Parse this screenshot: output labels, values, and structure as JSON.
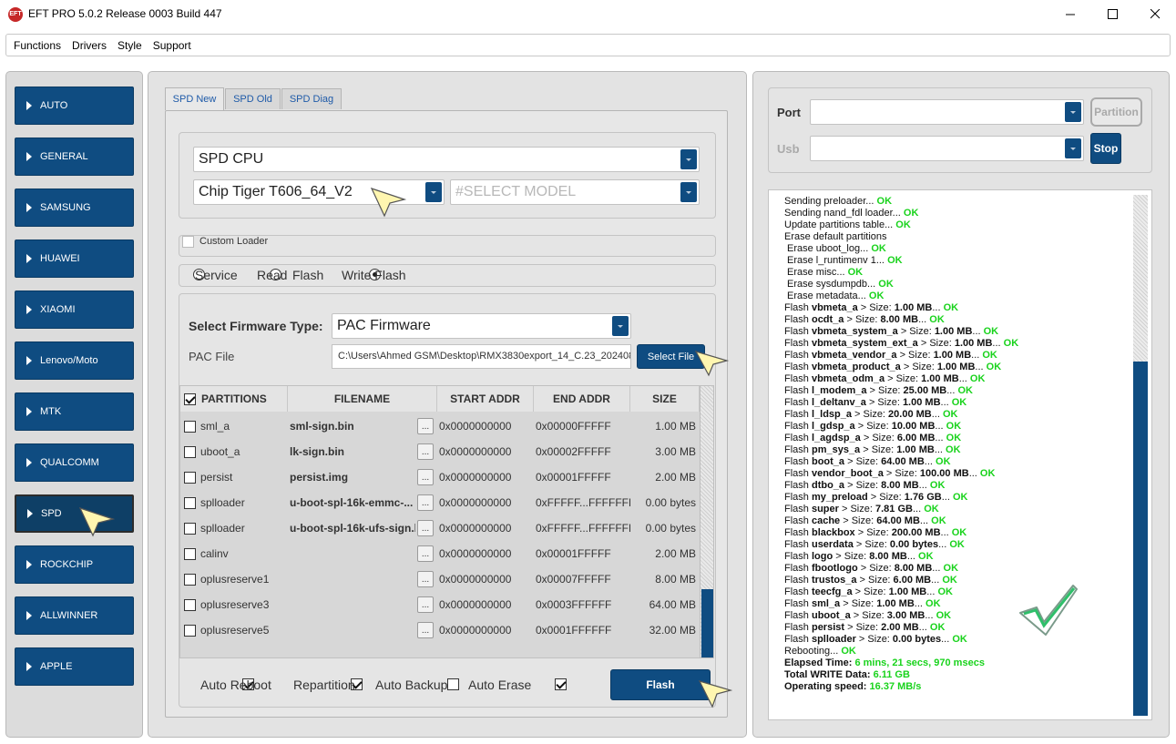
{
  "window": {
    "title": "EFT PRO 5.0.2 Release 0003 Build 447",
    "app_icon_text": "EFT",
    "minimize": "—",
    "maximize": "☐",
    "close": "✕"
  },
  "menu": [
    "Functions",
    "Drivers",
    "Style",
    "Support"
  ],
  "nav": {
    "items": [
      "AUTO",
      "GENERAL",
      "SAMSUNG",
      "HUAWEI",
      "XIAOMI",
      "Lenovo/Moto",
      "MTK",
      "QUALCOMM",
      "SPD",
      "ROCKCHIP",
      "ALLWINNER",
      "APPLE"
    ],
    "active": "SPD"
  },
  "tabs": [
    "SPD New",
    "SPD Old",
    "SPD Diag"
  ],
  "cpu_select": "SPD CPU",
  "chip_select": "Chip Tiger T606_64_V2",
  "model_placeholder": "#SELECT MODEL",
  "custom_loader": {
    "label": "Custom Loader",
    "checked": false
  },
  "modes": [
    {
      "label": "Service",
      "checked": false
    },
    {
      "label": "Read",
      "checked": false
    },
    {
      "label": "Flash",
      "checked": false
    },
    {
      "label": "Write Flash",
      "checked": true
    }
  ],
  "firmware": {
    "type_label": "Select Firmware Type:",
    "type_value": "PAC Firmware",
    "pac_label": "PAC File",
    "pac_path": "C:\\Users\\Ahmed GSM\\Desktop\\RMX3830export_14_C.23_202408",
    "select_file": "Select File"
  },
  "table": {
    "headers": [
      "PARTITIONS",
      "FILENAME",
      "START ADDR",
      "END ADDR",
      "SIZE"
    ],
    "rows": [
      {
        "name": "sml_a",
        "file": "sml-sign.bin",
        "start": "0x0000000000",
        "end": "0x00000FFFFF",
        "size": "1.00 MB"
      },
      {
        "name": "uboot_a",
        "file": "lk-sign.bin",
        "start": "0x0000000000",
        "end": "0x00002FFFFF",
        "size": "3.00 MB"
      },
      {
        "name": "persist",
        "file": "persist.img",
        "start": "0x0000000000",
        "end": "0x00001FFFFF",
        "size": "2.00 MB"
      },
      {
        "name": "splloader",
        "file": "u-boot-spl-16k-emmc-...",
        "start": "0x0000000000",
        "end": "0xFFFFF...FFFFFFF",
        "size": "0.00 bytes"
      },
      {
        "name": "splloader",
        "file": "u-boot-spl-16k-ufs-sign.b",
        "start": "0x0000000000",
        "end": "0xFFFFF...FFFFFFF",
        "size": "0.00 bytes"
      },
      {
        "name": "calinv",
        "file": "",
        "start": "0x0000000000",
        "end": "0x00001FFFFF",
        "size": "2.00 MB"
      },
      {
        "name": "oplusreserve1",
        "file": "",
        "start": "0x0000000000",
        "end": "0x00007FFFFF",
        "size": "8.00 MB"
      },
      {
        "name": "oplusreserve3",
        "file": "",
        "start": "0x0000000000",
        "end": "0x0003FFFFFF",
        "size": "64.00 MB"
      },
      {
        "name": "oplusreserve5",
        "file": "",
        "start": "0x0000000000",
        "end": "0x0001FFFFFF",
        "size": "32.00 MB"
      }
    ],
    "browse": "..."
  },
  "options": [
    {
      "label": "Auto Reboot",
      "checked": true
    },
    {
      "label": "Repartition",
      "checked": true
    },
    {
      "label": "Auto Backup",
      "checked": false
    },
    {
      "label": "Auto Erase",
      "checked": true
    }
  ],
  "flash_button": "Flash",
  "port": {
    "label": "Port",
    "button": "Partition"
  },
  "usb": {
    "label": "Usb",
    "button": "Stop"
  },
  "log": [
    {
      "text": "Sending preloader... ",
      "ok": "OK",
      "indent": 0,
      "bold": false
    },
    {
      "text": "Sending nand_fdl loader... ",
      "ok": "OK",
      "indent": 0,
      "bold": false
    },
    {
      "text": "Update partitions table... ",
      "ok": "OK",
      "indent": 0,
      "bold": false
    },
    {
      "text": "Erase default partitions",
      "ok": "",
      "indent": 0,
      "bold": false
    },
    {
      "text": "Erase uboot_log... ",
      "ok": "OK",
      "indent": 1,
      "bold": false
    },
    {
      "text": "Erase l_runtimenv 1... ",
      "ok": "OK",
      "indent": 1,
      "bold": false
    },
    {
      "text": "Erase misc... ",
      "ok": "OK",
      "indent": 1,
      "bold": false
    },
    {
      "text": "Erase sysdumpdb... ",
      "ok": "OK",
      "indent": 1,
      "bold": false
    },
    {
      "text": "Erase metadata... ",
      "ok": "OK",
      "indent": 1,
      "bold": false
    },
    {
      "pre": "Flash ",
      "name": "vbmeta_a",
      "text": " > Size: ",
      "size": "1.00 MB",
      "ok": "OK"
    },
    {
      "pre": "Flash ",
      "name": "ocdt_a",
      "text": " > Size: ",
      "size": "8.00 MB",
      "ok": "OK"
    },
    {
      "pre": "Flash ",
      "name": "vbmeta_system_a",
      "text": " > Size: ",
      "size": "1.00 MB",
      "ok": "OK"
    },
    {
      "pre": "Flash ",
      "name": "vbmeta_system_ext_a",
      "text": " > Size: ",
      "size": "1.00 MB",
      "ok": "OK"
    },
    {
      "pre": "Flash ",
      "name": "vbmeta_vendor_a",
      "text": " > Size: ",
      "size": "1.00 MB",
      "ok": "OK"
    },
    {
      "pre": "Flash ",
      "name": "vbmeta_product_a",
      "text": " > Size: ",
      "size": "1.00 MB",
      "ok": "OK"
    },
    {
      "pre": "Flash ",
      "name": "vbmeta_odm_a",
      "text": " > Size: ",
      "size": "1.00 MB",
      "ok": "OK"
    },
    {
      "pre": "Flash ",
      "name": "l_modem_a",
      "text": " > Size: ",
      "size": "25.00 MB",
      "ok": "OK"
    },
    {
      "pre": "Flash ",
      "name": "l_deltanv_a",
      "text": " > Size: ",
      "size": "1.00 MB",
      "ok": "OK"
    },
    {
      "pre": "Flash ",
      "name": "l_ldsp_a",
      "text": " > Size: ",
      "size": "20.00 MB",
      "ok": "OK"
    },
    {
      "pre": "Flash ",
      "name": "l_gdsp_a",
      "text": " > Size: ",
      "size": "10.00 MB",
      "ok": "OK"
    },
    {
      "pre": "Flash ",
      "name": "l_agdsp_a",
      "text": " > Size: ",
      "size": "6.00 MB",
      "ok": "OK"
    },
    {
      "pre": "Flash ",
      "name": "pm_sys_a",
      "text": " > Size: ",
      "size": "1.00 MB",
      "ok": "OK"
    },
    {
      "pre": "Flash ",
      "name": "boot_a",
      "text": " > Size: ",
      "size": "64.00 MB",
      "ok": "OK"
    },
    {
      "pre": "Flash ",
      "name": "vendor_boot_a",
      "text": " > Size: ",
      "size": "100.00 MB",
      "ok": "OK"
    },
    {
      "pre": "Flash ",
      "name": "dtbo_a",
      "text": " > Size: ",
      "size": "8.00 MB",
      "ok": "OK"
    },
    {
      "pre": "Flash ",
      "name": "my_preload",
      "text": " > Size: ",
      "size": "1.76 GB",
      "ok": "OK"
    },
    {
      "pre": "Flash ",
      "name": "super",
      "text": " > Size: ",
      "size": "7.81 GB",
      "ok": "OK"
    },
    {
      "pre": "Flash ",
      "name": "cache",
      "text": " > Size: ",
      "size": "64.00 MB",
      "ok": "OK"
    },
    {
      "pre": "Flash ",
      "name": "blackbox",
      "text": " > Size: ",
      "size": "200.00 MB",
      "ok": "OK"
    },
    {
      "pre": "Flash ",
      "name": "userdata",
      "text": " > Size: ",
      "size": "0.00 bytes",
      "ok": "OK"
    },
    {
      "pre": "Flash ",
      "name": "logo",
      "text": " > Size: ",
      "size": "8.00 MB",
      "ok": "OK"
    },
    {
      "pre": "Flash ",
      "name": "fbootlogo",
      "text": " > Size: ",
      "size": "8.00 MB",
      "ok": "OK"
    },
    {
      "pre": "Flash ",
      "name": "trustos_a",
      "text": " > Size: ",
      "size": "6.00 MB",
      "ok": "OK"
    },
    {
      "pre": "Flash ",
      "name": "teecfg_a",
      "text": " > Size: ",
      "size": "1.00 MB",
      "ok": "OK"
    },
    {
      "pre": "Flash ",
      "name": "sml_a",
      "text": " > Size: ",
      "size": "1.00 MB",
      "ok": "OK"
    },
    {
      "pre": "Flash ",
      "name": "uboot_a",
      "text": " > Size: ",
      "size": "3.00 MB",
      "ok": "OK"
    },
    {
      "pre": "Flash ",
      "name": "persist",
      "text": " > Size: ",
      "size": "2.00 MB",
      "ok": "OK"
    },
    {
      "pre": "Flash ",
      "name": "splloader",
      "text": " > Size: ",
      "size": "0.00 bytes",
      "ok": "OK"
    },
    {
      "text": "Rebooting... ",
      "ok": "OK",
      "indent": 0,
      "bold": false
    }
  ],
  "summary": [
    {
      "label": "Elapsed Time: ",
      "value": "6 mins, 21 secs, 970 msecs"
    },
    {
      "label": "Total WRITE Data: ",
      "value": "6.11 GB"
    },
    {
      "label": "Operating speed: ",
      "value": "16.37 MB/s"
    }
  ],
  "log_scroll_fraction": 0.83,
  "table_scroll_fraction": 0.25,
  "colors": {
    "accent": "#0f4c81",
    "ok": "#19d31c"
  }
}
